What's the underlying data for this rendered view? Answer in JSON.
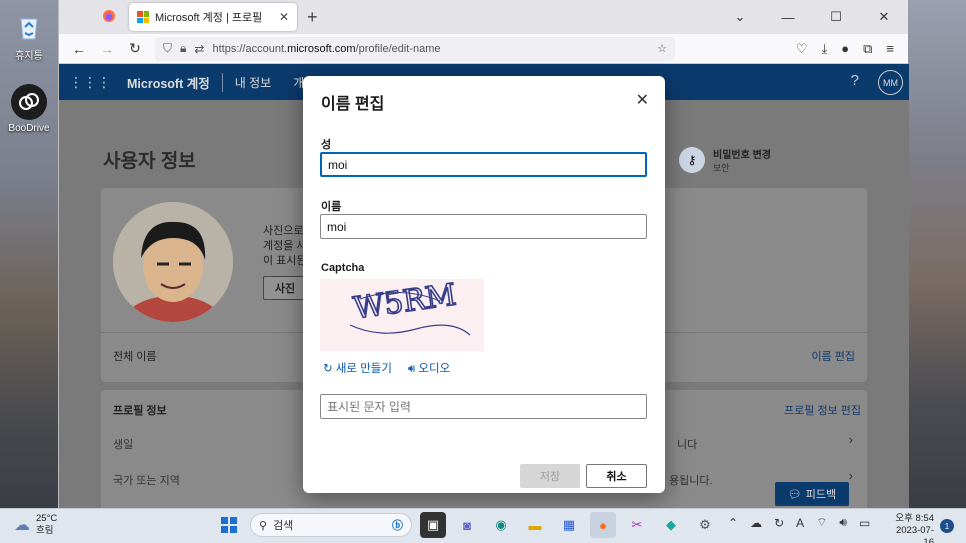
{
  "desktop": {
    "icons": [
      {
        "label": "휴지통",
        "icon": "recycle-bin-icon"
      },
      {
        "label": "BooDrive",
        "icon": "boodrive-icon"
      }
    ]
  },
  "browser": {
    "tab_title": "Microsoft 계정 | 프로필",
    "url_prefix": "https://account.",
    "url_domain": "microsoft.com",
    "url_path": "/profile/edit-name"
  },
  "header": {
    "brand": "Microsoft 계정",
    "nav_my_info": "내 정보",
    "nav_personal": "개인 정",
    "help": "?",
    "avatar_initials": "MM"
  },
  "page": {
    "title": "사용자 정보",
    "password_title": "비밀번호 변경",
    "password_sub": "보안",
    "photo_text_1": "사진으로",
    "photo_text_2": "계정을 사",
    "photo_text_3": "이 표시된",
    "photo_button": "사진",
    "full_name_label": "전체 이름",
    "edit_name_link": "이름 편집",
    "profile_info_header": "프로필 정보",
    "edit_profile_link": "프로필 정보 편집",
    "birthday_label": "생일",
    "country_label": "국가 또는 지역",
    "row1_trailing": "니다",
    "row2_trailing": "용됩니다.",
    "feedback": "피드백"
  },
  "modal": {
    "title": "이름 편집",
    "last_name_label": "성",
    "last_name_value": "moi",
    "first_name_label": "이름",
    "first_name_value": "moi",
    "captcha_label": "Captcha",
    "captcha_text": "W5RM",
    "refresh_label": "새로 만들기",
    "audio_label": "오디오",
    "captcha_placeholder": "표시된 문자 입력",
    "save_label": "저장",
    "cancel_label": "취소"
  },
  "taskbar": {
    "temperature": "25°C",
    "weather": "흐림",
    "search_label": "검색",
    "time": "오후 8:54",
    "date": "2023-07-16",
    "notification_count": "1"
  }
}
